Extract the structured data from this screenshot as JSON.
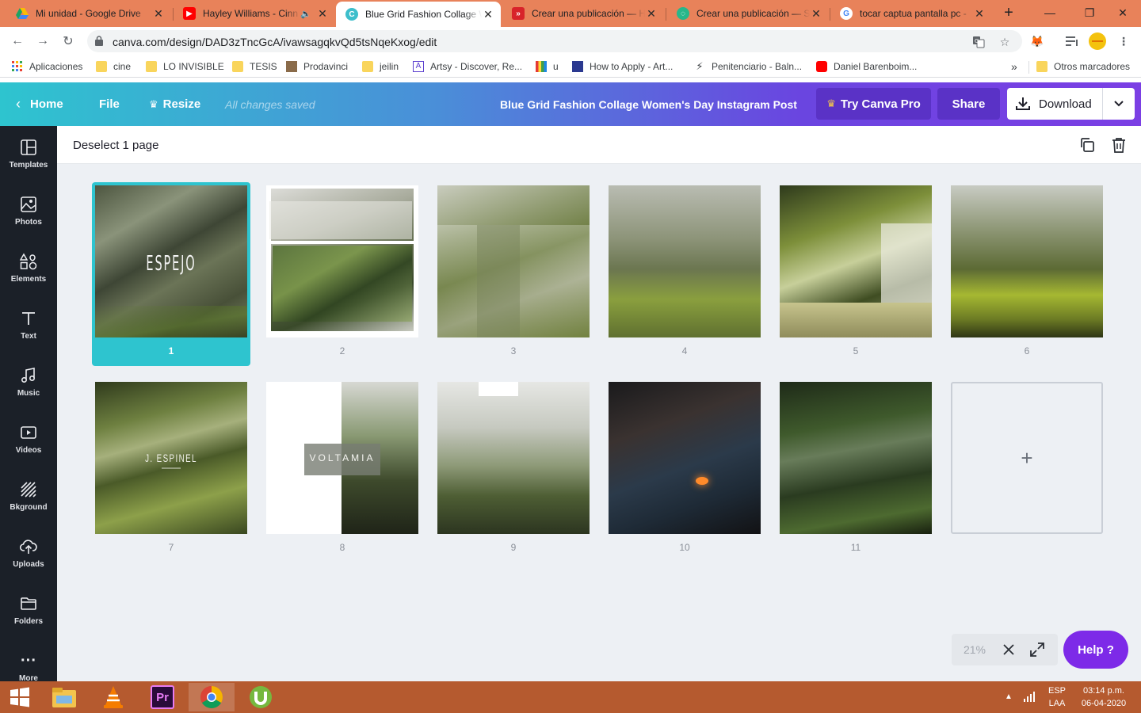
{
  "browser": {
    "tabs": [
      {
        "label": "Mi unidad - Google Drive",
        "icon": "google-drive-icon"
      },
      {
        "label": "Hayley Williams - Cinn",
        "icon": "youtube-icon"
      },
      {
        "label": "Blue Grid Fashion Collage W",
        "icon": "canva-icon"
      },
      {
        "label": "Crear una publicación — H",
        "icon": "site-icon"
      },
      {
        "label": "Crear una publicación — S",
        "icon": "site-icon"
      },
      {
        "label": "tocar captua pantalla pc - ",
        "icon": "google-icon"
      }
    ],
    "url": "canva.com/design/DAD3zTncGcA/ivawsagqkvQd5tsNqeKxog/edit",
    "bookmarks": [
      {
        "label": "Aplicaciones",
        "icon": "apps-grid-icon"
      },
      {
        "label": "cine",
        "icon": "folder-icon"
      },
      {
        "label": "LO INVISIBLE",
        "icon": "folder-icon"
      },
      {
        "label": "TESIS",
        "icon": "folder-icon"
      },
      {
        "label": "Prodavinci",
        "icon": "site-icon"
      },
      {
        "label": "jeilin",
        "icon": "folder-icon"
      },
      {
        "label": "Artsy - Discover, Re...",
        "icon": "artsy-icon"
      },
      {
        "label": "u",
        "icon": "site-icon"
      },
      {
        "label": "How to Apply - Art...",
        "icon": "site-icon"
      },
      {
        "label": "Penitenciario - Baln...",
        "icon": "bolt-icon"
      },
      {
        "label": "Daniel Barenboim...",
        "icon": "youtube-icon"
      },
      {
        "label": "»",
        "icon": ""
      },
      {
        "label": "Otros marcadores",
        "icon": "folder-icon"
      }
    ]
  },
  "header": {
    "home": "Home",
    "file": "File",
    "resize": "Resize",
    "saved": "All changes saved",
    "title": "Blue Grid Fashion Collage Women's Day Instagram Post",
    "try_pro": "Try Canva Pro",
    "share": "Share",
    "download": "Download"
  },
  "sidebar": {
    "items": [
      {
        "label": "Templates",
        "icon": "templates-icon"
      },
      {
        "label": "Photos",
        "icon": "photos-icon"
      },
      {
        "label": "Elements",
        "icon": "elements-icon"
      },
      {
        "label": "Text",
        "icon": "text-icon"
      },
      {
        "label": "Music",
        "icon": "music-icon"
      },
      {
        "label": "Videos",
        "icon": "videos-icon"
      },
      {
        "label": "Bkground",
        "icon": "background-icon"
      },
      {
        "label": "Uploads",
        "icon": "uploads-icon"
      },
      {
        "label": "Folders",
        "icon": "folder-icon"
      },
      {
        "label": "More",
        "icon": "more-icon"
      }
    ]
  },
  "workspace": {
    "deselect": "Deselect 1 page",
    "pages": [
      {
        "num": "1",
        "text": "ESPEJO",
        "selected": true
      },
      {
        "num": "2",
        "text": ""
      },
      {
        "num": "3",
        "text": ""
      },
      {
        "num": "4",
        "text": ""
      },
      {
        "num": "5",
        "text": ""
      },
      {
        "num": "6",
        "text": ""
      },
      {
        "num": "7",
        "text": "J. ESPINEL"
      },
      {
        "num": "8",
        "text": "VOLTAMIA"
      },
      {
        "num": "9",
        "text": ""
      },
      {
        "num": "10",
        "text": ""
      },
      {
        "num": "11",
        "text": ""
      }
    ],
    "zoom": "21%",
    "help": "Help ?"
  },
  "taskbar": {
    "lang": "ESP",
    "lang2": "LAA",
    "time": "03:14 p.m.",
    "date": "06-04-2020"
  },
  "colors": {
    "canva_teal": "#2ec4cf",
    "canva_purple": "#7d2ae8",
    "sidebar_bg": "#1b2028",
    "chrome_tabstrip": "#e8825a",
    "taskbar": "#b55a2f"
  }
}
